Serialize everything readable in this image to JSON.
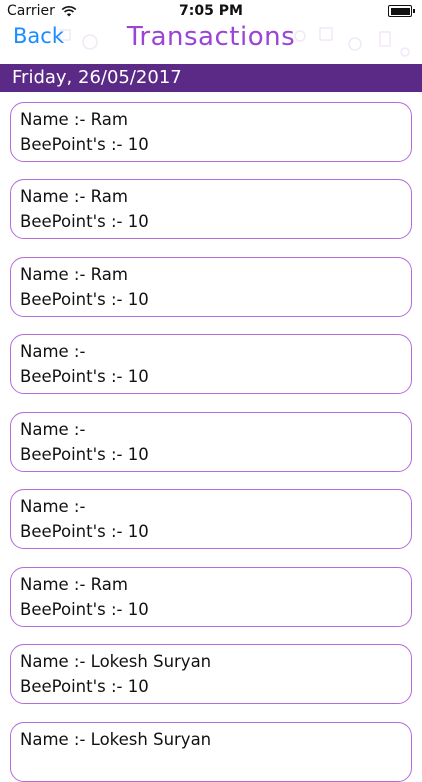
{
  "status_bar": {
    "carrier": "Carrier",
    "time": "7:05 PM"
  },
  "nav": {
    "back_label": "Back",
    "title": "Transactions",
    "back_color": "#1a8cff",
    "title_color": "#9b44d6"
  },
  "section": {
    "date": "Friday, 26/05/2017",
    "header_color": "#5b2a86"
  },
  "transactions": [
    {
      "name_label": "Name :- Ram",
      "points_label": "BeePoint's :- 10"
    },
    {
      "name_label": "Name :- Ram",
      "points_label": "BeePoint's :- 10"
    },
    {
      "name_label": "Name :- Ram",
      "points_label": "BeePoint's :- 10"
    },
    {
      "name_label": "Name :-",
      "points_label": "BeePoint's :- 10"
    },
    {
      "name_label": "Name :-",
      "points_label": "BeePoint's :- 10"
    },
    {
      "name_label": "Name :-",
      "points_label": "BeePoint's :- 10"
    },
    {
      "name_label": "Name :- Ram",
      "points_label": "BeePoint's :- 10"
    },
    {
      "name_label": "Name :- Lokesh Suryan",
      "points_label": "BeePoint's :- 10"
    },
    {
      "name_label": "Name :- Lokesh Suryan",
      "points_label": ""
    }
  ]
}
